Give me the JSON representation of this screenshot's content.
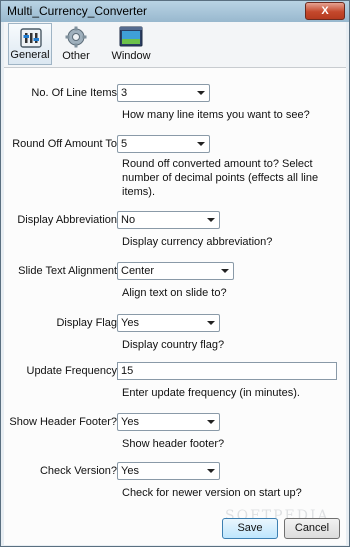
{
  "window": {
    "title": "Multi_Currency_Converter",
    "close_glyph": "X"
  },
  "toolbar": {
    "tabs": [
      {
        "label": "General",
        "icon": "general-settings-icon",
        "active": true
      },
      {
        "label": "Other",
        "icon": "gear-icon",
        "active": false
      },
      {
        "label": "Window",
        "icon": "window-icon",
        "active": false
      }
    ]
  },
  "form": {
    "line_items": {
      "label": "No. Of Line Items",
      "value": "3",
      "hint": "How many line items you want to see?"
    },
    "round_off": {
      "label": "Round Off Amount To",
      "value": "5",
      "hint_1": "Round off converted amount to? Select",
      "hint_2": "number of decimal points (effects all line",
      "hint_3": "items)."
    },
    "display_abbreviation": {
      "label": "Display Abbreviation",
      "value": "No",
      "hint": "Display currency abbreviation?"
    },
    "slide_text_alignment": {
      "label": "Slide Text Alignment",
      "value": "Center",
      "hint": "Align text on slide to?"
    },
    "display_flag": {
      "label": "Display Flag",
      "value": "Yes",
      "hint": "Display country flag?"
    },
    "update_frequency": {
      "label": "Update Frequency",
      "value": "15",
      "hint": "Enter update frequency (in minutes)."
    },
    "show_header_footer": {
      "label": "Show Header Footer?",
      "value": "Yes",
      "hint": "Show header footer?"
    },
    "check_version": {
      "label": "Check Version?",
      "value": "Yes",
      "hint": "Check for newer version on start up?"
    }
  },
  "buttons": {
    "save": "Save",
    "cancel": "Cancel"
  },
  "watermark": "SOFTPEDIA"
}
